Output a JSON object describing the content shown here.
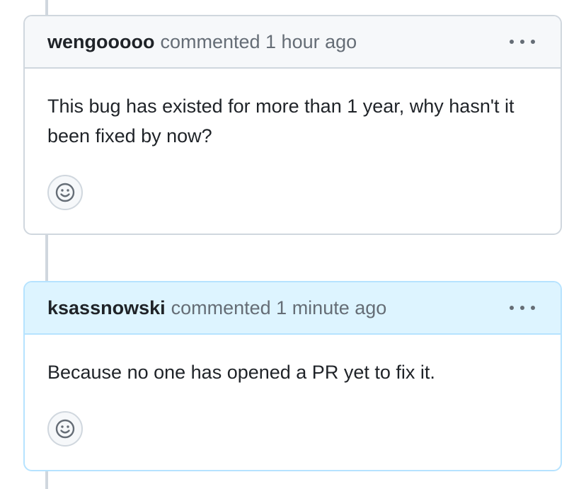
{
  "comments": [
    {
      "author": "wengooooo",
      "meta": "commented 1 hour ago",
      "body": "This bug has existed for more than 1 year, why hasn't it been fixed by now?",
      "icon": "smiley-icon"
    },
    {
      "author": "ksassnowski",
      "meta": "commented 1 minute ago",
      "body": "Because no one has opened a PR yet to fix it.",
      "icon": "smiley-icon"
    }
  ],
  "colors": {
    "border": "#d0d7de",
    "header_bg": "#f6f8fa",
    "highlight_header_bg": "#ddf4ff",
    "highlight_border": "#b6e3ff",
    "muted_text": "#656d76"
  },
  "icons": {
    "more": "kebab-horizontal-icon",
    "reaction": "smiley-icon"
  }
}
